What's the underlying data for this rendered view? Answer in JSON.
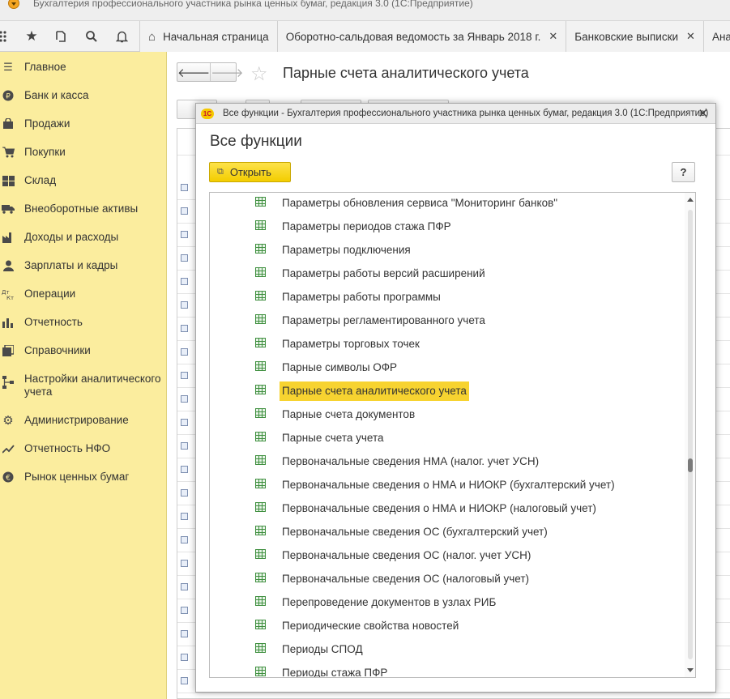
{
  "window": {
    "title": "Бухгалтерия профессионального участника рынка ценных бумаг, редакция 3.0  (1С:Предприятие)"
  },
  "toolbar": {
    "icons": [
      "apps-grid-icon",
      "favorites-star-icon",
      "history-icon",
      "search-icon",
      "notifications-bell-icon"
    ]
  },
  "tabs": [
    {
      "label": "Начальная страница",
      "icon": "home-icon"
    },
    {
      "label": "Оборотно-сальдовая ведомость за Январь 2018 г.",
      "closable": true
    },
    {
      "label": "Банковские выписки",
      "closable": true
    },
    {
      "label": "Анализ с"
    }
  ],
  "sidebar": {
    "items": [
      {
        "label": "Главное",
        "icon": "menu-lines-icon"
      },
      {
        "label": "Банк и касса",
        "icon": "ruble-coin-icon"
      },
      {
        "label": "Продажи",
        "icon": "shopping-bag-icon"
      },
      {
        "label": "Покупки",
        "icon": "shopping-cart-icon"
      },
      {
        "label": "Склад",
        "icon": "warehouse-grid-icon"
      },
      {
        "label": "Внеоборотные активы",
        "icon": "truck-icon"
      },
      {
        "label": "Доходы и расходы",
        "icon": "factory-icon"
      },
      {
        "label": "Зарплаты и кадры",
        "icon": "person-icon"
      },
      {
        "label": "Операции",
        "icon": "debit-credit-icon"
      },
      {
        "label": "Отчетность",
        "icon": "bar-chart-icon"
      },
      {
        "label": "Справочники",
        "icon": "books-icon"
      },
      {
        "label": "Настройки аналитического учета",
        "icon": "hierarchy-icon"
      },
      {
        "label": "Администрирование",
        "icon": "gear-icon"
      },
      {
        "label": "Отчетность НФО",
        "icon": "trend-line-icon"
      },
      {
        "label": "Рынок ценных бумаг",
        "icon": "euro-coin-icon"
      }
    ]
  },
  "page": {
    "title": "Парные счета аналитического учета"
  },
  "modal": {
    "window_title": "Все функции - Бухгалтерия профессионального участника рынка ценных бумаг, редакция 3.0  (1С:Предприятие)",
    "logo_text": "1С",
    "heading": "Все функции",
    "open_button_label": "Открыть",
    "help_button_label": "?",
    "items": [
      "Параметры обновления сервиса \"Мониторинг банков\"",
      "Параметры периодов стажа ПФР",
      "Параметры подключения",
      "Параметры работы версий расширений",
      "Параметры работы программы",
      "Параметры регламентированного учета",
      "Параметры торговых точек",
      "Парные символы ОФР",
      "Парные счета аналитического учета",
      "Парные счета документов",
      "Парные счета учета",
      "Первоначальные сведения НМА (налог. учет УСН)",
      "Первоначальные сведения о НМА и НИОКР (бухгалтерский учет)",
      "Первоначальные сведения о НМА и НИОКР (налоговый учет)",
      "Первоначальные сведения ОС (бухгалтерский учет)",
      "Первоначальные сведения ОС (налог. учет УСН)",
      "Первоначальные сведения ОС (налоговый учет)",
      "Перепроведение документов в узлах РИБ",
      "Периодические свойства новостей",
      "Периоды СПОД",
      "Периоды стажа ПФР"
    ],
    "selected_item": "Парные счета аналитического учета"
  },
  "colors": {
    "sidebar_bg": "#fbed9e",
    "selection": "#f7d330",
    "open_button": "#f3cd00"
  }
}
